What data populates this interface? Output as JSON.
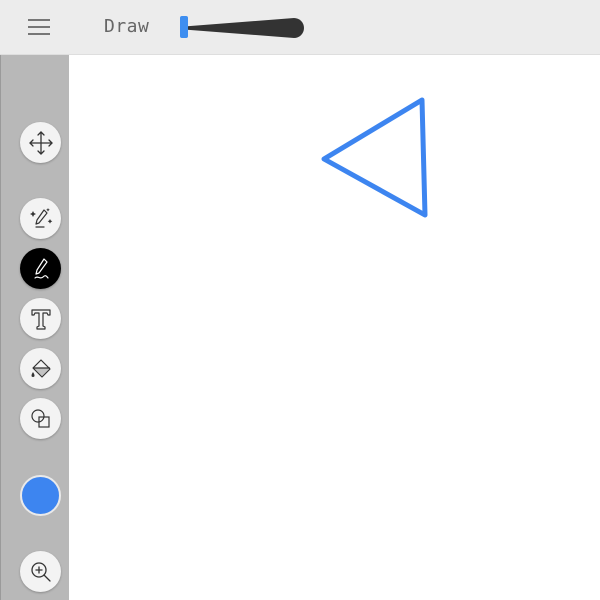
{
  "header": {
    "title": "Draw",
    "menu_icon": "hamburger-menu-icon",
    "brush_size_slider": {
      "icon": "brush-taper-icon",
      "accent_color": "#3e8ef0"
    }
  },
  "sidebar": {
    "tools": [
      {
        "id": "move",
        "icon": "move-arrows-icon",
        "active": false
      },
      {
        "id": "magic-pen",
        "icon": "magic-pen-icon",
        "active": false
      },
      {
        "id": "pen",
        "icon": "pen-icon",
        "active": true
      },
      {
        "id": "text",
        "icon": "text-icon",
        "active": false
      },
      {
        "id": "fill",
        "icon": "paint-bucket-icon",
        "active": false
      },
      {
        "id": "shapes",
        "icon": "shapes-icon",
        "active": false
      }
    ],
    "current_color": "#3d85f0",
    "zoom_icon": "zoom-in-icon"
  },
  "canvas": {
    "background": "#ffffff",
    "strokes": [
      {
        "shape": "triangle",
        "color": "#3d85f0"
      }
    ]
  }
}
